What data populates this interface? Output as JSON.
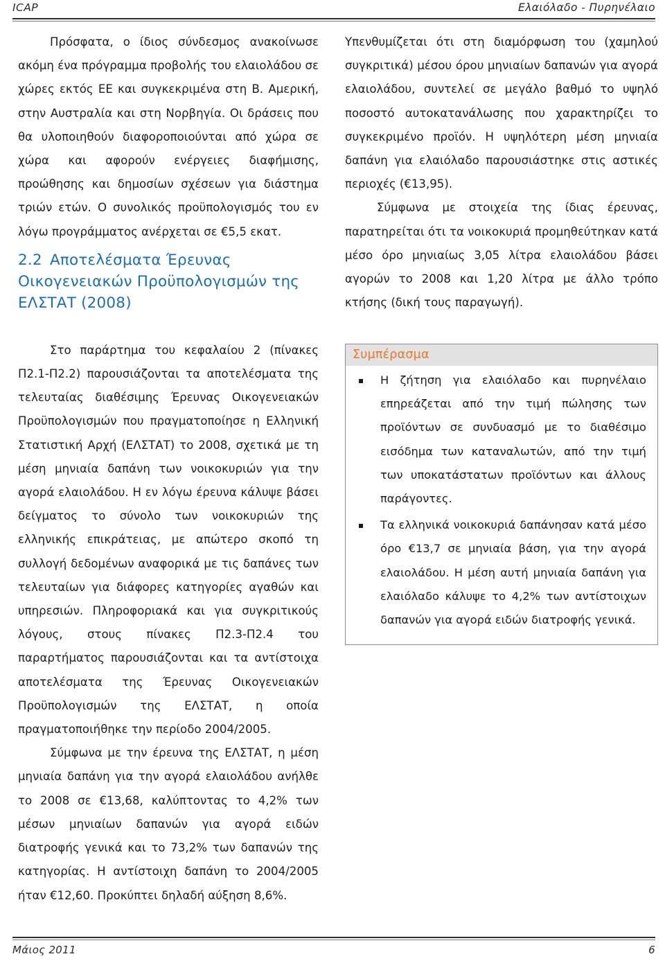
{
  "header": {
    "left_label": "ICAP",
    "right_label": "Ελαιόλαδο - Πυρηνέλαιο"
  },
  "footer": {
    "date_label": "Μάιος 2011",
    "page_number": "6"
  },
  "left_column": {
    "paragraph_1": "Πρόσφατα, ο ίδιος σύνδεσμος ανακοίνωσε ακόμη ένα πρόγραμμα προβολής του ελαιολάδου σε χώρες εκτός ΕΕ και συγκεκριμένα στη Β. Αμερική, στην Αυστραλία και στη Νορβηγία. Οι δράσεις που θα υλοποιηθούν διαφοροποιούνται από χώρα σε χώρα και αφορούν ενέργειες διαφήμισης, προώθησης και δημοσίων σχέσεων για διάστημα τριών ετών. Ο συνολικός προϋπολογισμός του εν λόγω προγράμματος ανέρχεται σε €5,5 εκατ.",
    "section_number": "2.2",
    "section_title": "Αποτελέσματα Έρευνας Οικογενειακών Προϋπολογισμών της ΕΛΣΤΑΤ (2008)",
    "paragraph_2": "Στο παράρτημα του κεφαλαίου 2 (πίνακες Π2.1-Π2.2) παρουσιάζονται τα αποτελέσματα της τελευταίας διαθέσιμης Έρευνας Οικογενειακών Προϋπολογισμών που πραγματοποίησε η Ελληνική Στατιστική Αρχή (ΕΛΣΤΑΤ) το 2008, σχετικά με τη μέση μηνιαία δαπάνη των νοικοκυριών για την αγορά ελαιολάδου. Η εν λόγω έρευνα κάλυψε βάσει δείγματος το σύνολο των νοικοκυριών της ελληνικής επικράτειας, με απώτερο σκοπό τη συλλογή δεδομένων αναφορικά με τις δαπάνες των τελευταίων για διάφορες κατηγορίες αγαθών και υπηρεσιών. Πληροφοριακά και για συγκριτικούς λόγους, στους πίνακες Π2.3-Π2.4 του παραρτήματος παρουσιάζονται και τα αντίστοιχα αποτελέσματα της Έρευνας Οικογενειακών Προϋπολογισμών της ΕΛΣΤΑΤ, η οποία πραγματοποιήθηκε την περίοδο 2004/2005.",
    "paragraph_3": "Σύμφωνα με την έρευνα της ΕΛΣΤΑΤ, η μέση μηνιαία δαπάνη για την αγορά ελαιολάδου ανήλθε το 2008 σε €13,68, καλύπτοντας το 4,2% των μέσων μηνιαίων δαπανών για αγορά ειδών διατροφής γενικά και το 73,2% των δαπανών της κατηγορίας. Η αντίστοιχη δαπάνη το 2004/2005 ήταν €12,60. Προκύπτει δηλαδή αύξηση 8,6%."
  },
  "right_column": {
    "paragraph_1": "Υπενθυμίζεται ότι στη διαμόρφωση του (χαμηλού συγκριτικά) μέσου όρου μηνιαίων δαπανών για αγορά ελαιολάδου, συντελεί σε μεγάλο βαθμό το υψηλό ποσοστό αυτοκατανάλωσης που χαρακτηρίζει το συγκεκριμένο προϊόν. Η υψηλότερη μέση μηνιαία δαπάνη για ελαιόλαδο παρουσιάστηκε στις αστικές περιοχές (€13,95).",
    "paragraph_2": "Σύμφωνα με στοιχεία της ίδιας έρευνας, παρατηρείται ότι τα νοικοκυριά προμηθεύτηκαν κατά μέσο όρο μηνιαίως 3,05 λίτρα ελαιολάδου βάσει αγορών το 2008 και 1,20 λίτρα με άλλο τρόπο κτήσης (δική τους παραγωγή)."
  },
  "conclusion": {
    "title": "Συμπέρασμα",
    "bullets": [
      "Η ζήτηση για ελαιόλαδο και πυρηνέλαιο επηρεάζεται από την τιμή πώλησης των προϊόντων σε συνδυασμό με το διαθέσιμο εισόδημα των καταναλωτών, από την τιμή των υποκατάστατων προϊόντων και άλλους παράγοντες.",
      "Τα ελληνικά νοικοκυριά δαπάνησαν κατά μέσο όρο €13,7 σε μηνιαία βάση, για την αγορά ελαιολάδου. Η μέση αυτή μηνιαία δαπάνη για ελαιόλαδο κάλυψε το 4,2% των αντίστοιχων δαπανών για αγορά ειδών διατροφής γενικά."
    ]
  },
  "colors": {
    "heading_blue": "#1a6fae",
    "conclusion_orange": "#e8772a",
    "conclusion_bar_gray": "#e2e2e2",
    "rule_dark": "#2f2f2f"
  }
}
